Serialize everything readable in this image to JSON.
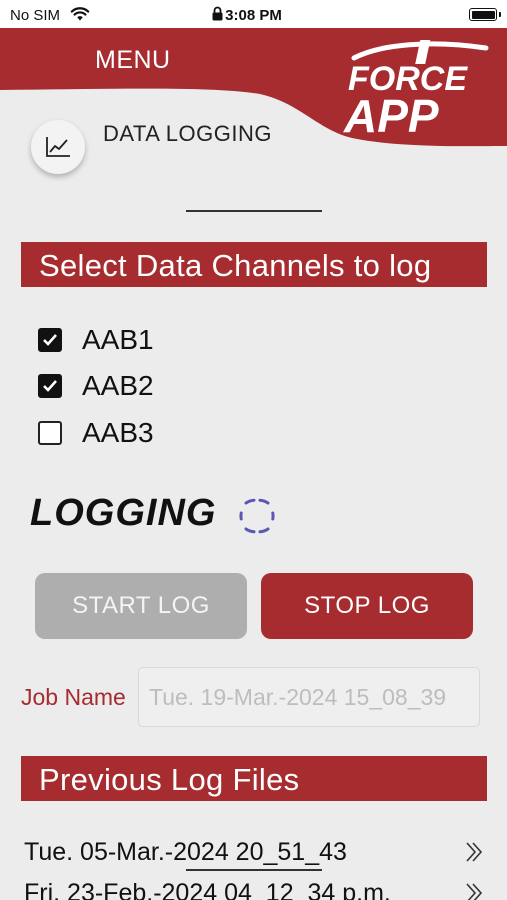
{
  "status_bar": {
    "carrier": "No SIM",
    "time": "3:08 PM"
  },
  "header": {
    "menu_label": "MENU",
    "logo_line1": "FORCE",
    "logo_line2": "APP",
    "brand_color": "#a62c30"
  },
  "page": {
    "title": "DATA LOGGING",
    "icon": "line-chart-icon"
  },
  "channels_section": {
    "heading": "Select Data Channels to log",
    "channels": [
      {
        "label": "AAB1",
        "checked": true
      },
      {
        "label": "AAB2",
        "checked": true
      },
      {
        "label": "AAB3",
        "checked": false
      }
    ]
  },
  "logging_status": {
    "text": "LOGGING",
    "spinner_color": "#5a57b5"
  },
  "buttons": {
    "start_label": "START LOG",
    "stop_label": "STOP LOG"
  },
  "job": {
    "label": "Job Name",
    "placeholder": "Tue. 19-Mar.-2024 15_08_39"
  },
  "previous_section": {
    "heading": "Previous Log Files",
    "files": [
      {
        "name": "Tue. 05-Mar.-2024 20_51_43"
      },
      {
        "name": "Fri. 23-Feb.-2024 04_12_34 p.m."
      }
    ]
  }
}
